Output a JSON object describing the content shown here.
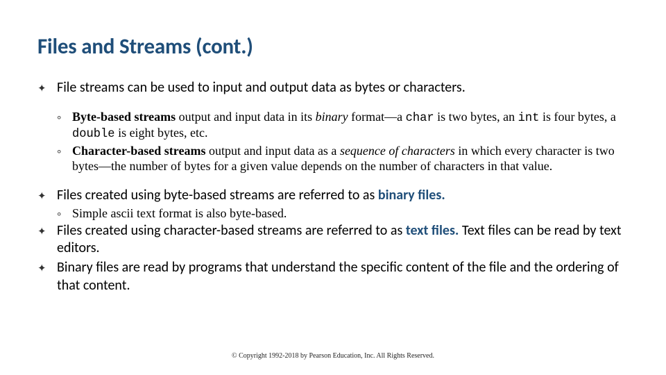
{
  "title": "Files and Streams (cont.)",
  "bullet1": "File streams can be used to input and output data as bytes or characters.",
  "sub1a_bold": "Byte-based streams",
  "sub1a_mid1": " output and input data in its ",
  "sub1a_ital": "binary",
  "sub1a_mid2": " format—a ",
  "sub1a_mono1": "char",
  "sub1a_mid3": " is two bytes, an ",
  "sub1a_mono2": "int",
  "sub1a_mid4": " is four bytes, a ",
  "sub1a_mono3": "double",
  "sub1a_end": " is eight bytes, etc.",
  "sub1b_bold": "Character-based streams",
  "sub1b_mid1": " output and input data as a ",
  "sub1b_ital": "sequence of characters",
  "sub1b_end": " in which every character is two bytes—the number of bytes for a given value depends on the number of characters in that value.",
  "bullet2_pre": "Files created using byte-based streams are referred to as ",
  "bullet2_blue": "binary files.",
  "sub2a": "Simple ascii text format is also byte-based.",
  "bullet3_pre": "Files created using character-based streams are referred to as ",
  "bullet3_blue": "text files.",
  "bullet3_post": " Text files can be read by text editors.",
  "bullet4": "Binary files are read by programs that understand the specific content of the file and the ordering of that content.",
  "footer": "© Copyright 1992-2018 by Pearson Education, Inc. All Rights Reserved.",
  "glyphs": {
    "main_bullet": "✦",
    "sub_bullet": "◦"
  }
}
